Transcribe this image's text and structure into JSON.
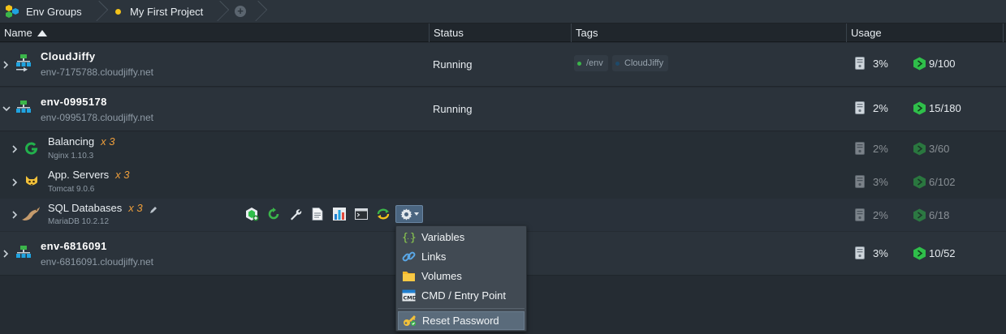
{
  "tabs": [
    {
      "label": "Env Groups"
    },
    {
      "label": "My First Project"
    }
  ],
  "columns": {
    "name": "Name",
    "status": "Status",
    "tags": "Tags",
    "usage": "Usage"
  },
  "envs": [
    {
      "name": "CloudJiffy",
      "domain": "env-7175788.cloudjiffy.net",
      "status": "Running",
      "tags": [
        "/env",
        "CloudJiffy"
      ],
      "disk": "3%",
      "cloudlets": "9/100"
    },
    {
      "name": "env-0995178",
      "domain": "env-0995178.cloudjiffy.net",
      "status": "Running",
      "disk": "2%",
      "cloudlets": "15/180"
    },
    {
      "name": "env-6816091",
      "domain": "env-6816091.cloudjiffy.net",
      "disk": "3%",
      "cloudlets": "10/52"
    }
  ],
  "nodes": [
    {
      "name": "Balancing",
      "count": "x 3",
      "version": "Nginx 1.10.3",
      "disk": "2%",
      "cloudlets": "3/60"
    },
    {
      "name": "App. Servers",
      "count": "x 3",
      "version": "Tomcat 9.0.6",
      "disk": "3%",
      "cloudlets": "6/102"
    },
    {
      "name": "SQL Databases",
      "count": "x 3",
      "version": "MariaDB 10.2.12",
      "disk": "2%",
      "cloudlets": "6/18"
    }
  ],
  "menu": {
    "items": [
      {
        "label": "Variables",
        "icon": "braces-icon"
      },
      {
        "label": "Links",
        "icon": "link-icon"
      },
      {
        "label": "Volumes",
        "icon": "folder-icon"
      },
      {
        "label": "CMD / Entry Point",
        "icon": "cmd-icon"
      },
      {
        "label": "Reset Password",
        "icon": "key-icon",
        "selected": true
      }
    ]
  },
  "colors": {
    "accent_green": "#2fbf4a",
    "bg": "#252c33",
    "row": "#2b333b",
    "orange": "#f0a03c"
  }
}
